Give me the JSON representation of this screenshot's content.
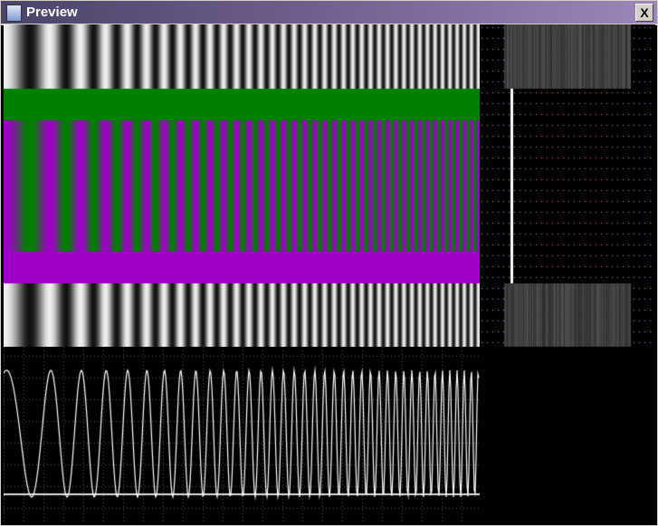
{
  "window": {
    "title": "Preview",
    "close_label": "X"
  },
  "colors": {
    "green": "#008000",
    "magenta": "#a000c8",
    "blue_dot": "#6fb8e8",
    "orange_dot": "#e88a3a"
  }
}
